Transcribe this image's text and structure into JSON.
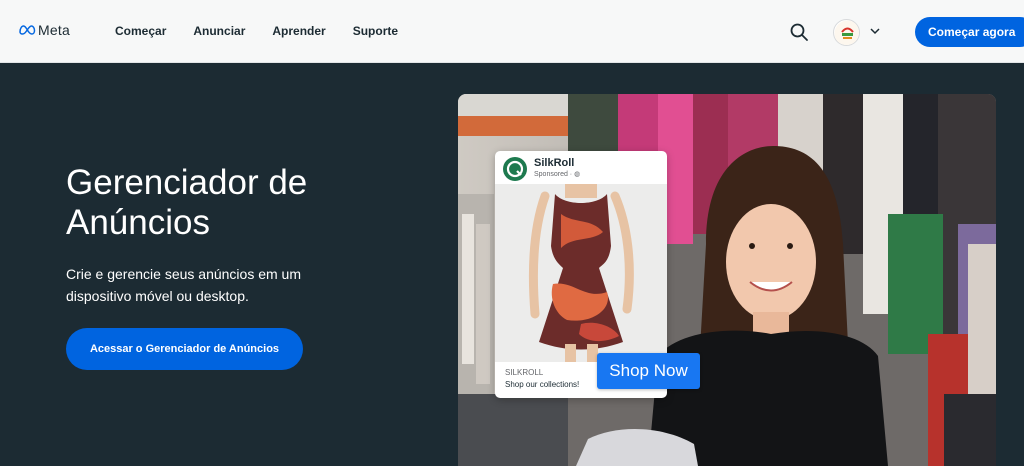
{
  "nav": {
    "logo_text": "Meta",
    "links": [
      "Começar",
      "Anunciar",
      "Aprender",
      "Suporte"
    ],
    "cta_label": "Começar agora"
  },
  "hero": {
    "title": "Gerenciador de Anúncios",
    "subtitle": "Crie e gerencie seus anúncios em um dispositivo móvel ou desktop.",
    "cta_label": "Acessar o Gerenciador de Anúncios"
  },
  "ad": {
    "brand": "SilkRoll",
    "sponsored": "Sponsored · ",
    "footer_name": "SILKROLL",
    "footer_text": "Shop our collections!",
    "cta_label": "Shop Now"
  },
  "colors": {
    "brand_blue": "#0064e0",
    "hero_bg": "#1c2b33",
    "ad_cta": "#1877f2"
  }
}
